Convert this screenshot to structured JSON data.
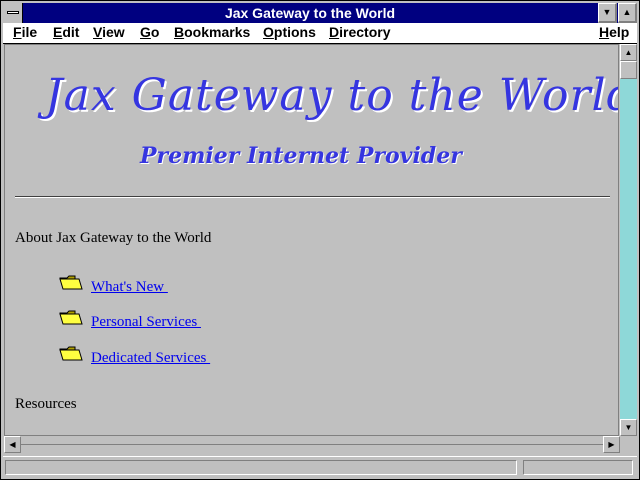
{
  "window": {
    "title": "Jax Gateway to the World"
  },
  "menubar": {
    "items": [
      {
        "label": "File",
        "accel": "F",
        "rest": "ile"
      },
      {
        "label": "Edit",
        "accel": "E",
        "rest": "dit"
      },
      {
        "label": "View",
        "accel": "V",
        "rest": "iew"
      },
      {
        "label": "Go",
        "accel": "G",
        "rest": "o"
      },
      {
        "label": "Bookmarks",
        "accel": "B",
        "rest": "ookmarks"
      },
      {
        "label": "Options",
        "accel": "O",
        "rest": "ptions"
      },
      {
        "label": "Directory",
        "accel": "D",
        "rest": "irectory"
      },
      {
        "label": "Help",
        "accel": "H",
        "rest": "elp"
      }
    ]
  },
  "page": {
    "logo_title": "Jax Gateway to the World",
    "logo_subtitle": "Premier Internet Provider",
    "about_heading": "About Jax Gateway to the World",
    "links": [
      {
        "label": "What's New "
      },
      {
        "label": "Personal Services "
      },
      {
        "label": "Dedicated Services "
      }
    ],
    "resources_heading": "Resources"
  },
  "status": {
    "text": ""
  },
  "colors": {
    "titlebar": "#000080",
    "link": "#0000ee",
    "logo": "#3535e0",
    "scroll_track": "#8ed8d8"
  },
  "icons": {
    "folder": "folder-icon"
  }
}
